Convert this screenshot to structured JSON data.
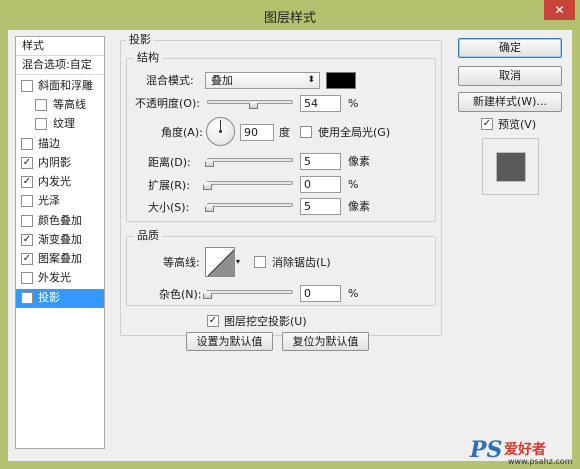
{
  "window": {
    "title": "图层样式",
    "close_icon": "close-icon"
  },
  "style_list": {
    "header": "样式",
    "blend_options": "混合选项:自定",
    "items": [
      {
        "label": "斜面和浮雕",
        "checked": false
      },
      {
        "label": "等高线",
        "checked": false,
        "sub": true
      },
      {
        "label": "纹理",
        "checked": false,
        "sub": true
      },
      {
        "label": "描边",
        "checked": false
      },
      {
        "label": "内阴影",
        "checked": true
      },
      {
        "label": "内发光",
        "checked": true
      },
      {
        "label": "光泽",
        "checked": false
      },
      {
        "label": "颜色叠加",
        "checked": false
      },
      {
        "label": "渐变叠加",
        "checked": true
      },
      {
        "label": "图案叠加",
        "checked": true
      },
      {
        "label": "外发光",
        "checked": false
      },
      {
        "label": "投影",
        "checked": true,
        "selected": true
      }
    ]
  },
  "drop_shadow": {
    "section_title": "投影",
    "structure": {
      "title": "结构",
      "blend_mode_label": "混合模式:",
      "blend_mode_value": "叠加",
      "shadow_color": "#000000",
      "opacity_label": "不透明度(O):",
      "opacity_value": "54",
      "opacity_unit": "%",
      "opacity_level": 0.54,
      "angle_label": "角度(A):",
      "angle_value": "90",
      "angle_unit": "度",
      "global_light_label": "使用全局光(G)",
      "global_light_checked": false,
      "distance_label": "距离(D):",
      "distance_value": "5",
      "distance_unit": "像素",
      "spread_label": "扩展(R):",
      "spread_value": "0",
      "spread_unit": "%",
      "size_label": "大小(S):",
      "size_value": "5",
      "size_unit": "像素"
    },
    "quality": {
      "title": "品质",
      "contour_label": "等高线:",
      "antialias_label": "消除锯齿(L)",
      "antialias_checked": false,
      "noise_label": "杂色(N):",
      "noise_value": "0",
      "noise_unit": "%"
    },
    "knockout_label": "图层挖空投影(U)",
    "knockout_checked": true,
    "set_default_label": "设置为默认值",
    "reset_default_label": "复位为默认值"
  },
  "buttons": {
    "ok": "确定",
    "cancel": "取消",
    "new_style": "新建样式(W)...",
    "preview_label": "预览(V)",
    "preview_checked": true
  },
  "watermark": {
    "brand": "PS",
    "name": "爱好者",
    "url": "www.psahz.com"
  },
  "colors": {
    "selected_row": "#3399ff",
    "titlebar": "#b3c06e",
    "close": "#c7443a"
  }
}
